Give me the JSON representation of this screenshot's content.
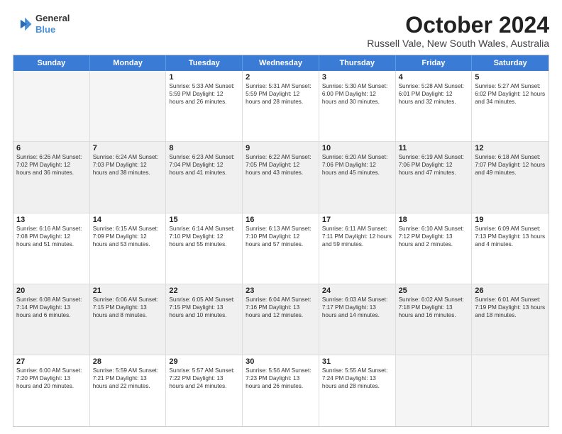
{
  "logo": {
    "line1": "General",
    "line2": "Blue"
  },
  "title": "October 2024",
  "subtitle": "Russell Vale, New South Wales, Australia",
  "header_days": [
    "Sunday",
    "Monday",
    "Tuesday",
    "Wednesday",
    "Thursday",
    "Friday",
    "Saturday"
  ],
  "rows": [
    [
      {
        "day": "",
        "info": "",
        "empty": true
      },
      {
        "day": "",
        "info": "",
        "empty": true
      },
      {
        "day": "1",
        "info": "Sunrise: 5:33 AM\nSunset: 5:59 PM\nDaylight: 12 hours\nand 26 minutes."
      },
      {
        "day": "2",
        "info": "Sunrise: 5:31 AM\nSunset: 5:59 PM\nDaylight: 12 hours\nand 28 minutes."
      },
      {
        "day": "3",
        "info": "Sunrise: 5:30 AM\nSunset: 6:00 PM\nDaylight: 12 hours\nand 30 minutes."
      },
      {
        "day": "4",
        "info": "Sunrise: 5:28 AM\nSunset: 6:01 PM\nDaylight: 12 hours\nand 32 minutes."
      },
      {
        "day": "5",
        "info": "Sunrise: 5:27 AM\nSunset: 6:02 PM\nDaylight: 12 hours\nand 34 minutes."
      }
    ],
    [
      {
        "day": "6",
        "info": "Sunrise: 6:26 AM\nSunset: 7:02 PM\nDaylight: 12 hours\nand 36 minutes.",
        "shaded": true
      },
      {
        "day": "7",
        "info": "Sunrise: 6:24 AM\nSunset: 7:03 PM\nDaylight: 12 hours\nand 38 minutes.",
        "shaded": true
      },
      {
        "day": "8",
        "info": "Sunrise: 6:23 AM\nSunset: 7:04 PM\nDaylight: 12 hours\nand 41 minutes.",
        "shaded": true
      },
      {
        "day": "9",
        "info": "Sunrise: 6:22 AM\nSunset: 7:05 PM\nDaylight: 12 hours\nand 43 minutes.",
        "shaded": true
      },
      {
        "day": "10",
        "info": "Sunrise: 6:20 AM\nSunset: 7:06 PM\nDaylight: 12 hours\nand 45 minutes.",
        "shaded": true
      },
      {
        "day": "11",
        "info": "Sunrise: 6:19 AM\nSunset: 7:06 PM\nDaylight: 12 hours\nand 47 minutes.",
        "shaded": true
      },
      {
        "day": "12",
        "info": "Sunrise: 6:18 AM\nSunset: 7:07 PM\nDaylight: 12 hours\nand 49 minutes.",
        "shaded": true
      }
    ],
    [
      {
        "day": "13",
        "info": "Sunrise: 6:16 AM\nSunset: 7:08 PM\nDaylight: 12 hours\nand 51 minutes."
      },
      {
        "day": "14",
        "info": "Sunrise: 6:15 AM\nSunset: 7:09 PM\nDaylight: 12 hours\nand 53 minutes."
      },
      {
        "day": "15",
        "info": "Sunrise: 6:14 AM\nSunset: 7:10 PM\nDaylight: 12 hours\nand 55 minutes."
      },
      {
        "day": "16",
        "info": "Sunrise: 6:13 AM\nSunset: 7:10 PM\nDaylight: 12 hours\nand 57 minutes."
      },
      {
        "day": "17",
        "info": "Sunrise: 6:11 AM\nSunset: 7:11 PM\nDaylight: 12 hours\nand 59 minutes."
      },
      {
        "day": "18",
        "info": "Sunrise: 6:10 AM\nSunset: 7:12 PM\nDaylight: 13 hours\nand 2 minutes."
      },
      {
        "day": "19",
        "info": "Sunrise: 6:09 AM\nSunset: 7:13 PM\nDaylight: 13 hours\nand 4 minutes."
      }
    ],
    [
      {
        "day": "20",
        "info": "Sunrise: 6:08 AM\nSunset: 7:14 PM\nDaylight: 13 hours\nand 6 minutes.",
        "shaded": true
      },
      {
        "day": "21",
        "info": "Sunrise: 6:06 AM\nSunset: 7:15 PM\nDaylight: 13 hours\nand 8 minutes.",
        "shaded": true
      },
      {
        "day": "22",
        "info": "Sunrise: 6:05 AM\nSunset: 7:15 PM\nDaylight: 13 hours\nand 10 minutes.",
        "shaded": true
      },
      {
        "day": "23",
        "info": "Sunrise: 6:04 AM\nSunset: 7:16 PM\nDaylight: 13 hours\nand 12 minutes.",
        "shaded": true
      },
      {
        "day": "24",
        "info": "Sunrise: 6:03 AM\nSunset: 7:17 PM\nDaylight: 13 hours\nand 14 minutes.",
        "shaded": true
      },
      {
        "day": "25",
        "info": "Sunrise: 6:02 AM\nSunset: 7:18 PM\nDaylight: 13 hours\nand 16 minutes.",
        "shaded": true
      },
      {
        "day": "26",
        "info": "Sunrise: 6:01 AM\nSunset: 7:19 PM\nDaylight: 13 hours\nand 18 minutes.",
        "shaded": true
      }
    ],
    [
      {
        "day": "27",
        "info": "Sunrise: 6:00 AM\nSunset: 7:20 PM\nDaylight: 13 hours\nand 20 minutes."
      },
      {
        "day": "28",
        "info": "Sunrise: 5:59 AM\nSunset: 7:21 PM\nDaylight: 13 hours\nand 22 minutes."
      },
      {
        "day": "29",
        "info": "Sunrise: 5:57 AM\nSunset: 7:22 PM\nDaylight: 13 hours\nand 24 minutes."
      },
      {
        "day": "30",
        "info": "Sunrise: 5:56 AM\nSunset: 7:23 PM\nDaylight: 13 hours\nand 26 minutes."
      },
      {
        "day": "31",
        "info": "Sunrise: 5:55 AM\nSunset: 7:24 PM\nDaylight: 13 hours\nand 28 minutes."
      },
      {
        "day": "",
        "info": "",
        "empty": true
      },
      {
        "day": "",
        "info": "",
        "empty": true
      }
    ]
  ]
}
